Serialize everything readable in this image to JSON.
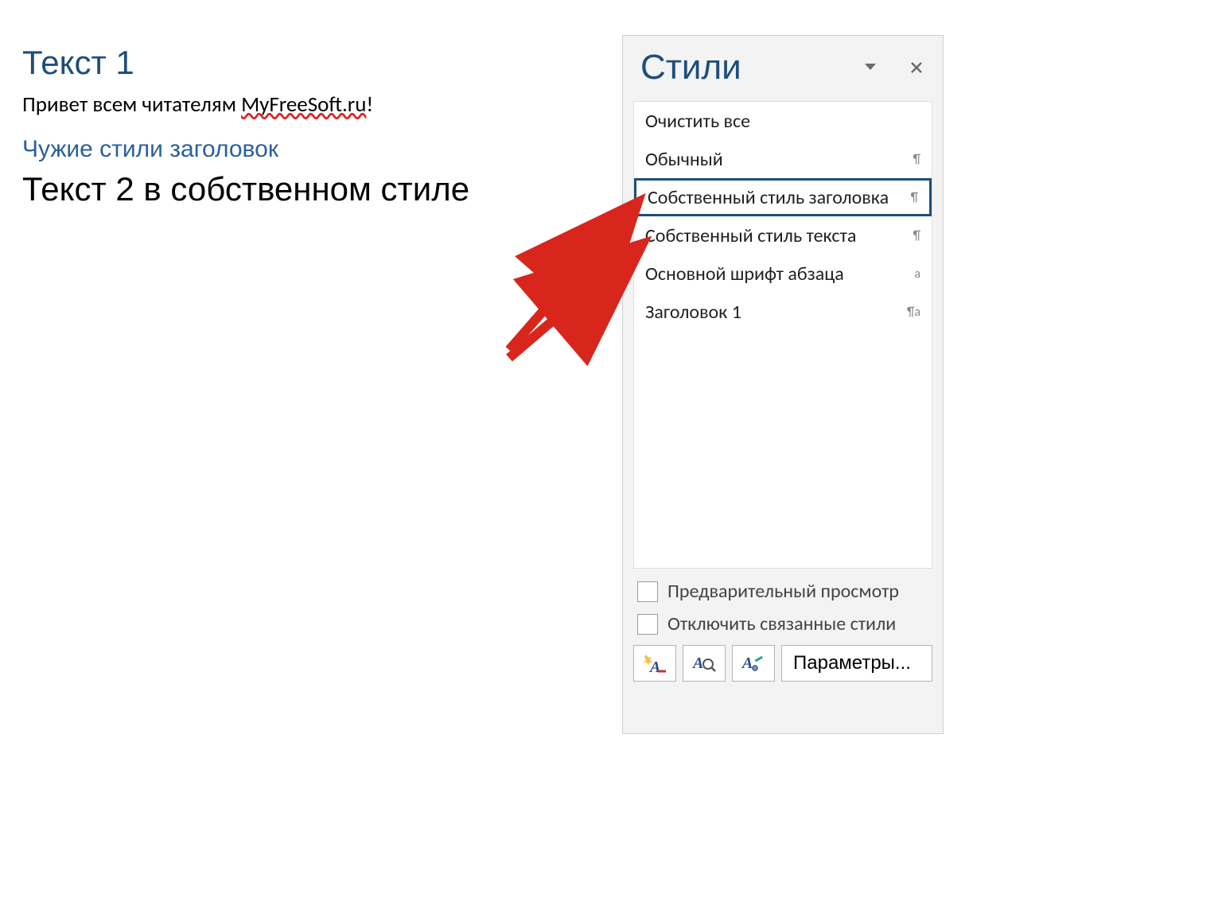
{
  "document": {
    "heading1": "Текст 1",
    "body_plain_prefix": "Привет всем читателям ",
    "body_spell_error": "MyFreeSoft.ru",
    "body_plain_suffix": "!",
    "alt_heading": "Чужие стили заголовок",
    "big_text": "Текст 2 в собственном стиле"
  },
  "pane": {
    "title": "Стили",
    "styles": [
      {
        "label": "Очистить все",
        "mark": "",
        "selected": false
      },
      {
        "label": "Обычный",
        "mark": "¶",
        "selected": false
      },
      {
        "label": "Собственный стиль заголовка",
        "mark": "¶",
        "selected": true
      },
      {
        "label": "Собственный стиль текста",
        "mark": "¶",
        "selected": false
      },
      {
        "label": "Основной шрифт абзаца",
        "mark": "a",
        "selected": false
      },
      {
        "label": "Заголовок 1",
        "mark": "¶a",
        "selected": false
      }
    ],
    "checkbox_preview": "Предварительный просмотр",
    "checkbox_disable_linked": "Отключить связанные стили",
    "params_button": "Параметры...",
    "icon_buttons": [
      "new-style-icon",
      "style-inspector-icon",
      "manage-styles-icon"
    ]
  },
  "colors": {
    "heading_blue": "#1f4e79",
    "link_blue": "#2a6099",
    "arrow_red": "#d9261c"
  }
}
